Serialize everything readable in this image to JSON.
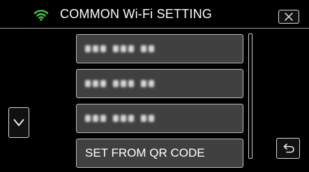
{
  "header": {
    "title": "COMMON Wi-Fi SETTING",
    "wifi_icon": "wifi-icon",
    "wifi_color": "#3fbf3f",
    "close_icon": "close-icon"
  },
  "list": {
    "items": [
      {
        "label": "",
        "obscured": true
      },
      {
        "label": "",
        "obscured": true
      },
      {
        "label": "",
        "obscured": true
      },
      {
        "label": "SET FROM QR CODE",
        "obscured": false
      }
    ]
  },
  "controls": {
    "scroll_down_icon": "chevron-down-icon",
    "back_icon": "back-arrow-icon"
  }
}
